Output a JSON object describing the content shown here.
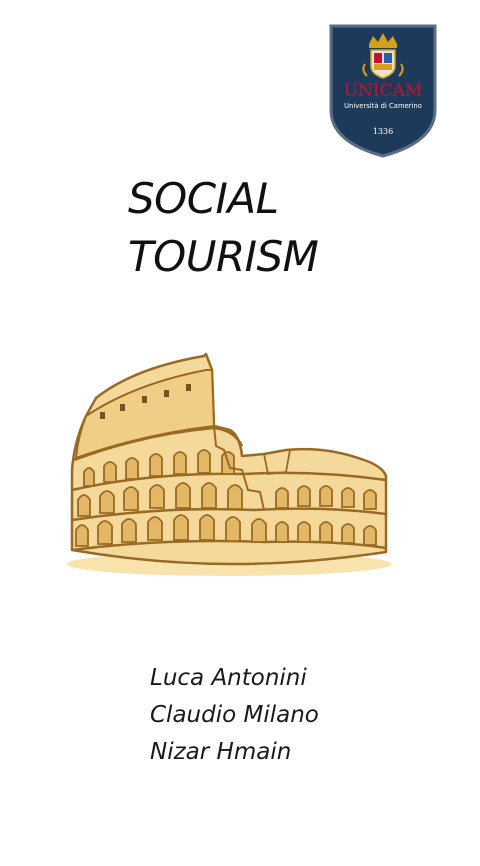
{
  "logo": {
    "name": "UNICAM",
    "subtitle": "Università di Camerino",
    "year": "1336",
    "colors": {
      "shield": "#1e3a5a",
      "border": "#5a6f83",
      "text": "#c8102e",
      "gold": "#d4a017"
    }
  },
  "title": {
    "line1": "SOCIAL",
    "line2": "TOURISM"
  },
  "illustration": {
    "icon": "colosseum-icon",
    "colors": {
      "fill": "#f5d99a",
      "shade": "#e2b866",
      "outline": "#9a6a25"
    }
  },
  "authors": [
    "Luca Antonini",
    "Claudio Milano",
    "Nizar Hmain"
  ]
}
